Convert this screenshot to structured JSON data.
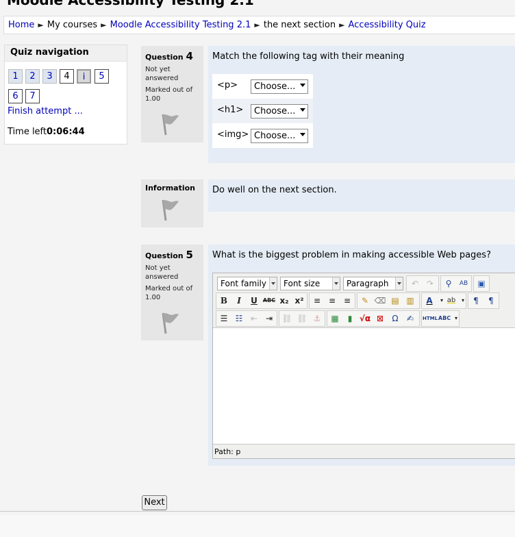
{
  "page": {
    "title": "Moodle Accessibility Testing 2.1"
  },
  "breadcrumb": {
    "separator": "►",
    "items": [
      {
        "label": "Home",
        "link": true
      },
      {
        "label": "My courses",
        "link": false
      },
      {
        "label": "Moodle Accessibility Testing 2.1",
        "link": true
      },
      {
        "label": "the next section",
        "link": false
      },
      {
        "label": "Accessibility Quiz",
        "link": true
      }
    ]
  },
  "quiz_nav": {
    "header": "Quiz navigation",
    "buttons": [
      "1",
      "2",
      "3",
      "4",
      "i",
      "5",
      "6",
      "7"
    ],
    "finish_label": "Finish attempt ...",
    "time_left_label": "Time left",
    "time_left_value": "0:06:44"
  },
  "questions": {
    "q4": {
      "label": "Question",
      "number": "4",
      "state": "Not yet answered",
      "grade": "Marked out of 1.00",
      "text": "Match the following tag with their meaning",
      "rows": [
        {
          "stem": "<p>",
          "choice": "Choose..."
        },
        {
          "stem": "<h1>",
          "choice": "Choose..."
        },
        {
          "stem": "<img>",
          "choice": "Choose..."
        }
      ]
    },
    "info": {
      "label": "Information",
      "text": "Do well on the next section."
    },
    "q5": {
      "label": "Question",
      "number": "5",
      "state": "Not yet answered",
      "grade": "Marked out of 1.00",
      "text": "What is the biggest problem in making accessible Web pages?"
    }
  },
  "editor": {
    "font_family": "Font family",
    "font_size": "Font size",
    "format": "Paragraph",
    "path": "Path: p"
  },
  "actions": {
    "next_label": "Next"
  },
  "colors": {
    "link": "#0000bb",
    "content_bg": "#e5ecf5",
    "info_bg": "#e6e6e6"
  }
}
